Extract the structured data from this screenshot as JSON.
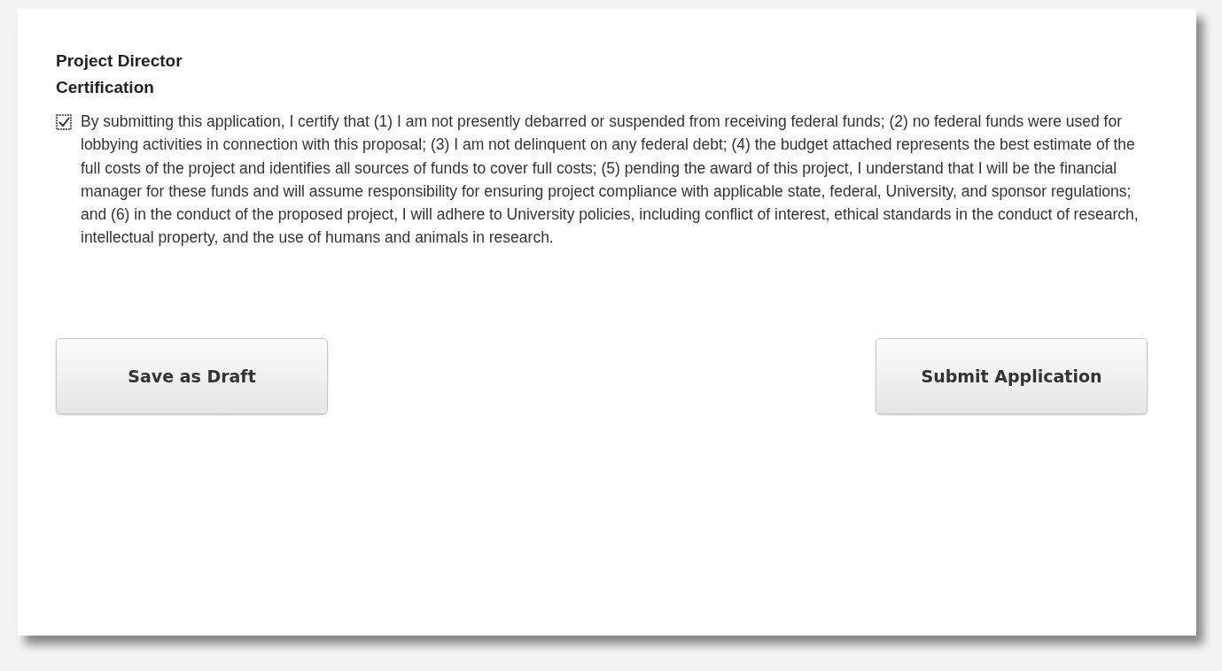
{
  "section": {
    "title_lines": [
      "Project Director",
      "Certification"
    ]
  },
  "certification": {
    "checked": true,
    "text": "By submitting this application, I certify that (1) I am not presently debarred or suspended from receiving federal funds; (2) no federal funds were used for lobbying activities in connection with this proposal; (3) I am not delinquent on any federal debt; (4) the budget attached represents the best estimate of the full costs of the project and identifies all sources of funds to cover full costs; (5) pending the award of this project, I understand that I will be the financial manager for these funds and will assume responsibility for ensuring project compliance with applicable state, federal, University, and sponsor regulations; and (6) in the conduct of the proposed project, I will adhere to University policies, including conflict of interest, ethical standards in the conduct of research, intellectual property, and the use of humans and animals in research."
  },
  "buttons": [
    {
      "label": "Save as Draft"
    },
    {
      "label": "Submit Application"
    }
  ]
}
